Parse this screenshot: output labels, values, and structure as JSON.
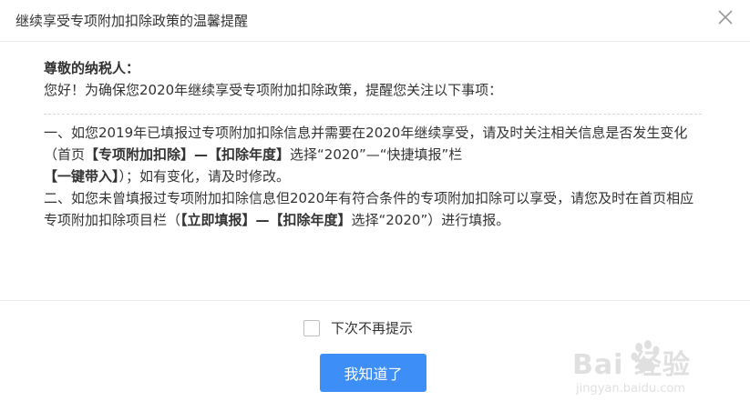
{
  "dialog": {
    "title": "继续享受专项附加扣除政策的温馨提醒",
    "close_icon": "close-icon"
  },
  "message": {
    "greeting": "尊敬的纳税人：",
    "intro": "您好！为确保您2020年继续享受专项附加扣除政策，提醒您关注以下事项：",
    "item1": {
      "p1": "一、如您2019年已填报过专项附加扣除信息并需要在2020年继续享受，请及时关注相关信息是否发生变化（首页",
      "b1": "【专项附加扣除】—【扣除年度】",
      "p2": "选择“2020”—“快捷填报”栏",
      "b2": "【一键带入】",
      "p3": "）；如有变化，请及时修改。"
    },
    "item2": {
      "p1": "二、如您未曾填报过专项附加扣除信息但2020年有符合条件的专项附加扣除可以享受，请您及时在首页相应专项附加扣除项目栏（",
      "b1": "【立即填报】—【扣除年度】",
      "p2": "选择“2020”）进行填报。"
    }
  },
  "footer": {
    "checkbox_label": "下次不再提示",
    "ok_label": "我知道了"
  },
  "watermark": {
    "logo_text": "Bai  经验",
    "url": "jingyan.baidu.com"
  },
  "colors": {
    "primary": "#3e8ef7",
    "text": "#333333",
    "border": "#e8e8e8"
  }
}
